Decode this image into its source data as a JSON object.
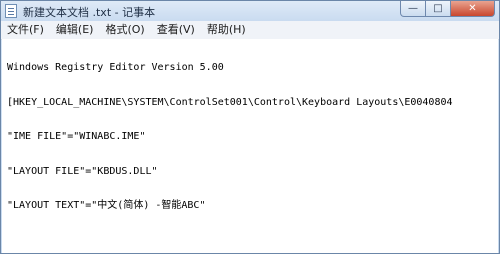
{
  "window": {
    "title": "新建文本文档 .txt - 记事本",
    "buttons": {
      "minimize": "—",
      "maximize": "□",
      "close": "✕"
    }
  },
  "menubar": {
    "items": [
      {
        "label": "文件(F)"
      },
      {
        "label": "编辑(E)"
      },
      {
        "label": "格式(O)"
      },
      {
        "label": "查看(V)"
      },
      {
        "label": "帮助(H)"
      }
    ]
  },
  "editor": {
    "lines": [
      "Windows Registry Editor Version 5.00",
      "[HKEY_LOCAL_MACHINE\\SYSTEM\\ControlSet001\\Control\\Keyboard Layouts\\E0040804",
      "\"IME FILE\"=\"WINABC.IME\"",
      "\"LAYOUT FILE\"=\"KBDUS.DLL\"",
      "\"LAYOUT TEXT\"=\"中文(简体) -智能ABC\""
    ]
  },
  "icons": {
    "app": "notepad-icon"
  }
}
